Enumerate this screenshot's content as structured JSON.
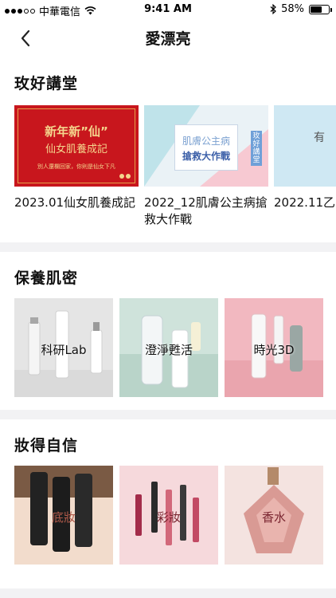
{
  "status_bar": {
    "carrier": "中華電信",
    "time": "9:41 AM",
    "battery": "58%",
    "battery_level": 0.58
  },
  "nav": {
    "title": "愛漂亮",
    "back_icon": "chevron-left-icon"
  },
  "lectures": {
    "title": "玫好講堂",
    "items": [
      {
        "caption": "2023.01仙女肌養成記",
        "thumb_title": "新年新”仙”",
        "thumb_subtitle": "仙女肌養成記",
        "thumb_note": "別人還欄回家，你則是仙女下凡"
      },
      {
        "caption": "2022_12肌膚公主病搶救大作戰",
        "thumb_title": "肌膚公主病",
        "thumb_subtitle": "搶救大作戰",
        "thumb_badge": "玫好講堂"
      },
      {
        "caption": "2022.11乙",
        "thumb_title": "有"
      }
    ]
  },
  "skincare": {
    "title": "保養肌密",
    "tiles": [
      {
        "label": "科研Lab"
      },
      {
        "label": "澄淨甦活"
      },
      {
        "label": "時光3D"
      }
    ]
  },
  "makeup": {
    "title": "妝得自信",
    "tiles": [
      {
        "label": "底妝"
      },
      {
        "label": "彩妝"
      },
      {
        "label": "香水"
      }
    ]
  },
  "colors": {
    "red_banner": "#c8161d",
    "gold_text": "#f4d58d",
    "divider": "#f2f2f4"
  }
}
